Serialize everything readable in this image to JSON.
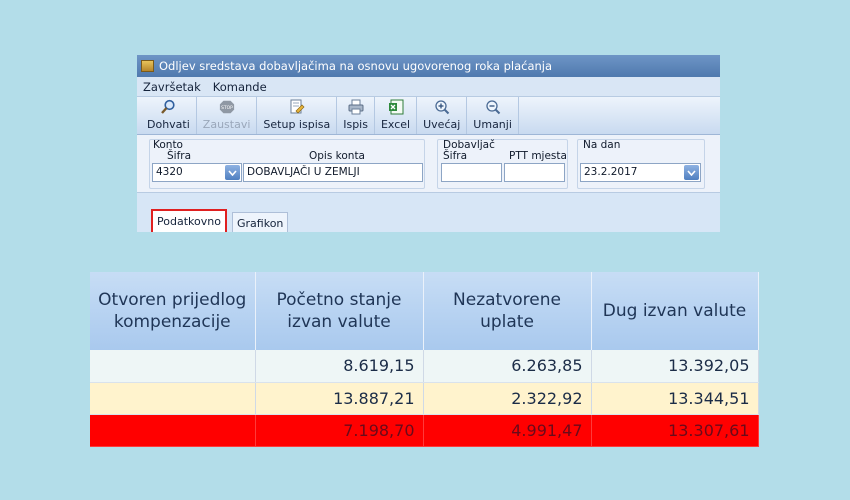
{
  "window": {
    "title": "Odljev sredstava dobavljačima na osnovu ugovorenog roka plaćanja"
  },
  "menu": [
    "Završetak",
    "Komande"
  ],
  "toolbar": {
    "fetch": "Dohvati",
    "stop": "Zaustavi",
    "stop_badge": "STOP",
    "setup_print": "Setup ispisa",
    "print": "Ispis",
    "excel": "Excel",
    "zoom_in": "Uvećaj",
    "zoom_out": "Umanji"
  },
  "filters": {
    "konto_label": "Konto",
    "sifra_label": "Šifra",
    "opis_label": "Opis konta",
    "konto_value": "4320",
    "opis_value": "DOBAVLJAČI U ZEMLJI",
    "dobavljac_label": "Dobavljač",
    "dob_sifra_label": "Šifra",
    "ptt_label": "PTT mjesta",
    "dob_sifra_value": "",
    "ptt_value": "",
    "na_dan_label": "Na dan",
    "na_dan_value": "23.2.2017"
  },
  "tabs": [
    "Podatkovno",
    "Grafikon"
  ],
  "table": {
    "headers": [
      "Otvoren prijedlog kompenzacije",
      "Početno stanje izvan valute",
      "Nezatvorene uplate",
      "Dug izvan valute"
    ],
    "rows": [
      [
        "",
        "8.619,15",
        "6.263,85",
        "13.392,05"
      ],
      [
        "",
        "13.887,21",
        "2.322,92",
        "13.344,51"
      ],
      [
        "",
        "7.198,70",
        "4.991,47",
        "13.307,61"
      ]
    ]
  },
  "colors": {
    "background": "#b3dde9",
    "header": "#b8d3f2",
    "row1": "#eef6f6",
    "row2": "#fff3cd",
    "row3_alert": "#ff0000",
    "active_tab_border": "#e02020"
  },
  "icons": {
    "app": "app-icon",
    "fetch": "magnifier-icon",
    "stop": "stop-icon",
    "setup_print": "page-setup-icon",
    "print": "printer-icon",
    "excel": "excel-icon",
    "zoom_in": "zoom-in-icon",
    "zoom_out": "zoom-out-icon",
    "combo": "chevron-down-icon"
  }
}
